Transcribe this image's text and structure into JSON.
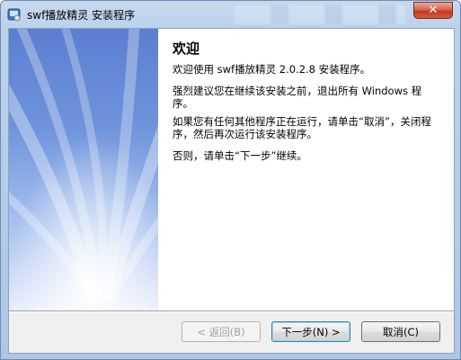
{
  "window": {
    "title": "swf播放精灵 安装程序",
    "close_label": "✕"
  },
  "page": {
    "heading": "欢迎",
    "paragraphs": [
      "欢迎使用 swf播放精灵 2.0.2.8 安装程序。",
      "强烈建议您在继续该安装之前，退出所有 Windows 程序。",
      "如果您有任何其他程序正在运行，请单击“取消”，关闭程序，然后再次运行该安装程序。",
      "否则，请单击“下一步”继续。"
    ]
  },
  "buttons": {
    "back": "< 返回(B)",
    "next": "下一步(N) >",
    "cancel": "取消(C)"
  },
  "colors": {
    "banner_top": "#5a7fcf",
    "banner_bottom": "#e8eefc",
    "close_red": "#c43a1e"
  },
  "icons": {
    "app": "installer-icon",
    "close": "close-icon"
  }
}
